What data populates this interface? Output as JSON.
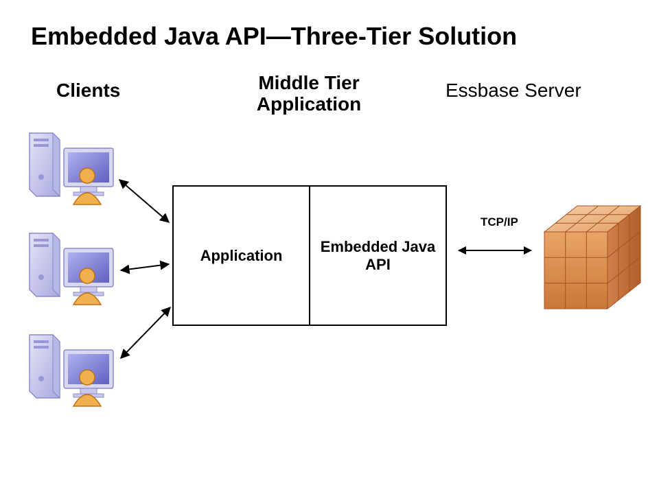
{
  "title": "Embedded Java API—Three-Tier Solution",
  "columns": {
    "clients": "Clients",
    "middle": "Middle Tier Application",
    "server": "Essbase Server"
  },
  "middle_tier": {
    "left_label": "Application",
    "right_label": "Embedded Java API"
  },
  "connection_label": "TCP/IP",
  "icons": {
    "client": "client-workstation-icon",
    "server_cube": "data-cube-icon"
  },
  "colors": {
    "client_tower": "#c8c8ec",
    "client_screen": "#8a8ae0",
    "client_user": "#f0a030",
    "cube_face": "#e0955a",
    "cube_top": "#efb990",
    "cube_edge": "#a55020"
  }
}
